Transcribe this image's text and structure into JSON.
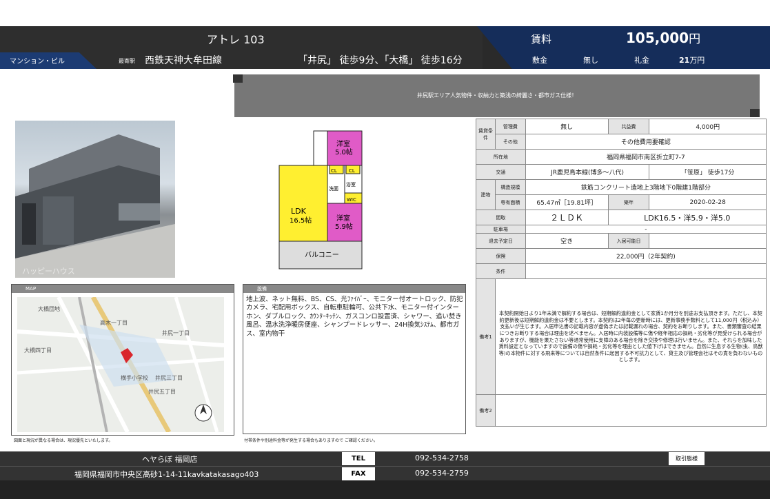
{
  "header": {
    "title": "アトレ 103",
    "tag": "マンション・ビル",
    "station_label": "最寄駅",
    "station": "西鉄天神大牟田線",
    "walk": "「井尻」 徒歩9分、「大橋」 徒歩16分",
    "rent_label": "賃料",
    "rent_value": "105,000",
    "rent_unit": "円",
    "deposit_label": "敷金",
    "deposit_value": "無し",
    "key_label": "礼金",
    "key_value": "21",
    "key_unit": "万円"
  },
  "banner": "井尻駅エリア人気物件・収納力と築浅の綺麗さ・都市ガス仕様！",
  "floorplan": {
    "room1": "洋室",
    "room1_size": "5.0帖",
    "ldk": "LDK",
    "ldk_size": "16.5帖",
    "room2": "洋室",
    "room2_size": "5.9帖",
    "balcony": "バルコニー",
    "cl": "CL",
    "wic": "WIC",
    "bath": "浴室",
    "wash": "洗面"
  },
  "map_label": "MAP",
  "map_places": [
    "大橋団地",
    "井尻一丁目",
    "大橋四丁目",
    "高木一丁目",
    "井尻三丁目",
    "井尻五丁目",
    "横手小学校"
  ],
  "equip_label": "設備",
  "equipment": "地上波、ネット無料、BS、CS、光ﾌｧｲﾊﾞｰ、モニター付オートロック、防犯カメラ、宅配用ボックス、自転車駐輪可、公共下水、モニター付インターホン、ダブルロック、ｶｳﾝﾀｰｷｯﾁﾝ、ガスコンロ設置済、シャワー、追い焚き風呂、温水洗浄暖房便座、シャンプードレッサー、24H換気ｼｽﾃﾑ、都市ガス、室内物干",
  "notes": {
    "plan_note": "図面と現況が異なる場合は、現況優先といたします。",
    "equip_note": "付帯条件や別途料金等が発生する場合もありますので ご確認ください。"
  },
  "spec": {
    "cond_label": "賃貸条件",
    "mgmt_label": "管理費",
    "mgmt_value": "無し",
    "common_label": "共益費",
    "common_value": "4,000円",
    "other_label": "その他",
    "other_value": "その他費用要確認",
    "address_label": "所在地",
    "address_value": "福岡県福岡市南区折立町7-7",
    "transport_label": "交通",
    "transport_value": "JR鹿児島本線(博多～八代)",
    "transport_walk": "「笹原」 徒歩17分",
    "building_label": "建物",
    "structure_label": "構造規模",
    "structure_value": "鉄筋コンクリート造地上3階地下0階建1階部分",
    "area_label": "専有面積",
    "area_value": "65.47㎡［19.81坪］",
    "age_label": "築年",
    "age_value": "2020-02-28",
    "layout_label": "間取",
    "layout_value": "２ＬＤＫ",
    "layout_detail": "LDK16.5・洋5.9・洋5.0",
    "parking_label": "駐車場",
    "parking_value": "-",
    "leave_label": "退去予定日",
    "leave_value": "空き",
    "move_label": "入居可能日",
    "move_value": "",
    "insurance_label": "保険",
    "insurance_value": "22,000円（2年契約)",
    "cond2_label": "条件",
    "cond2_value": "",
    "remarks1_label": "備考1",
    "remarks1": "本契約開始日より1年未満で解約する場合は、短期解約違約金として家賃1か月分を別途お支払頂きます。ただし、本契約更新後は短期解約違約金は不要とします。本契約は2年毎の更新時には、更新事務手数料として11,000円（税込み）支払いが生じます。入居申込書の記載内容が虚偽または記載漏れの場合、契約をお断りします。また、書類審査の結果につきお断りする場合は理由を述べません。入居時に内装設備等に傷や経年相応の損耗・劣化等が見受けられる場合がありますが、機能を果たさない等通常使用に支障のある場合を除き交換や修理は行いません。また、それらを加味した賃料設定となっていますので設備の傷や損耗・劣化等を理由とした値下げはできません。自然に生息する生物(虫、鳥獣等)の本物件に対する飛来等については自然条件に起因する不可抗力として、貸主及び管理会社はその責を負わないものとします。",
    "remarks2_label": "備考2",
    "remarks2": ""
  },
  "footer": {
    "company": "ヘヤらぼ 福岡店",
    "address": "福岡県福岡市中央区高砂1-14-11kavkatakasago403",
    "tel_label": "TEL",
    "tel": "092-534-2758",
    "fax_label": "FAX",
    "fax": "092-534-2759",
    "agent_label": "取引態様",
    "agent_value": ""
  }
}
